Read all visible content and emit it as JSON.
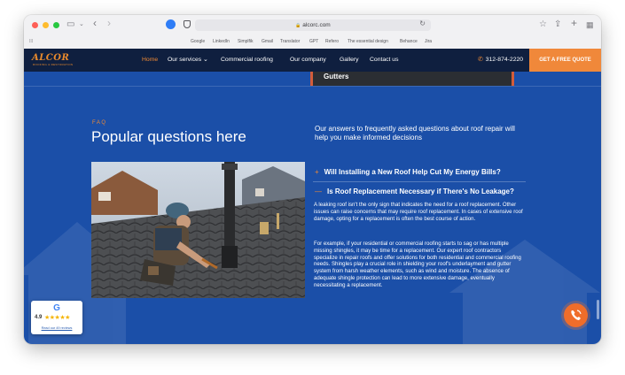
{
  "browser": {
    "url": "alcorc.com",
    "bookmarks": [
      "Google",
      "LinkedIn",
      "Simplfik",
      "Gmail",
      "Translator",
      "GPT",
      "Refero",
      "The essential design",
      "Behance",
      "Jira"
    ]
  },
  "site": {
    "logo": "ALCOR",
    "logo_tagline": "ROOFING & RESTORATION",
    "nav": [
      {
        "label": "Home",
        "active": true
      },
      {
        "label": "Our services ⌄",
        "active": false
      },
      {
        "label": "Commercial roofing",
        "active": false
      },
      {
        "label": "Our company",
        "active": false
      },
      {
        "label": "Gallery",
        "active": false
      },
      {
        "label": "Contact us",
        "active": false
      }
    ],
    "phone": "312-874-2220",
    "cta": "GET A FREE QUOTE"
  },
  "peek_card": "Gutters",
  "faq": {
    "eyebrow": "FAQ",
    "title": "Popular questions here",
    "intro": "Our answers to frequently asked questions about roof repair will help you make informed decisions",
    "items": [
      {
        "sign": "+",
        "question": "Will Installing a New Roof Help Cut My Energy Bills?",
        "open": false
      },
      {
        "sign": "—",
        "question": "Is Roof Replacement Necessary if There's No Leakage?",
        "open": true
      }
    ],
    "answer_paragraphs": [
      "A leaking roof isn't the only sign that indicates the need for a roof replacement. Other issues can raise concerns that may require roof replacement. In cases of extensive roof damage, opting for a replacement is often the best course of action.",
      "For example, if your residential or commercial roofing starts to sag or has multiple missing shingles, it may be time for a replacement. Our expert roof contractors specialize in repair roofs and offer solutions for both residential and commercial roofing needs. Shingles play a crucial role in shielding your roof's underlayment and gutter system from harsh weather elements, such as wind and moisture. The absence of adequate shingle protection can lead to more extensive damage, eventually necessitating a replacement."
    ]
  },
  "google_badge": {
    "letter": "G",
    "rating": "4.9",
    "stars": "★★★★★",
    "link": "Read our 49 reviews"
  },
  "colors": {
    "page_blue": "#1b4fa8",
    "nav_navy": "#0f1f3f",
    "accent_orange": "#f08a34"
  }
}
